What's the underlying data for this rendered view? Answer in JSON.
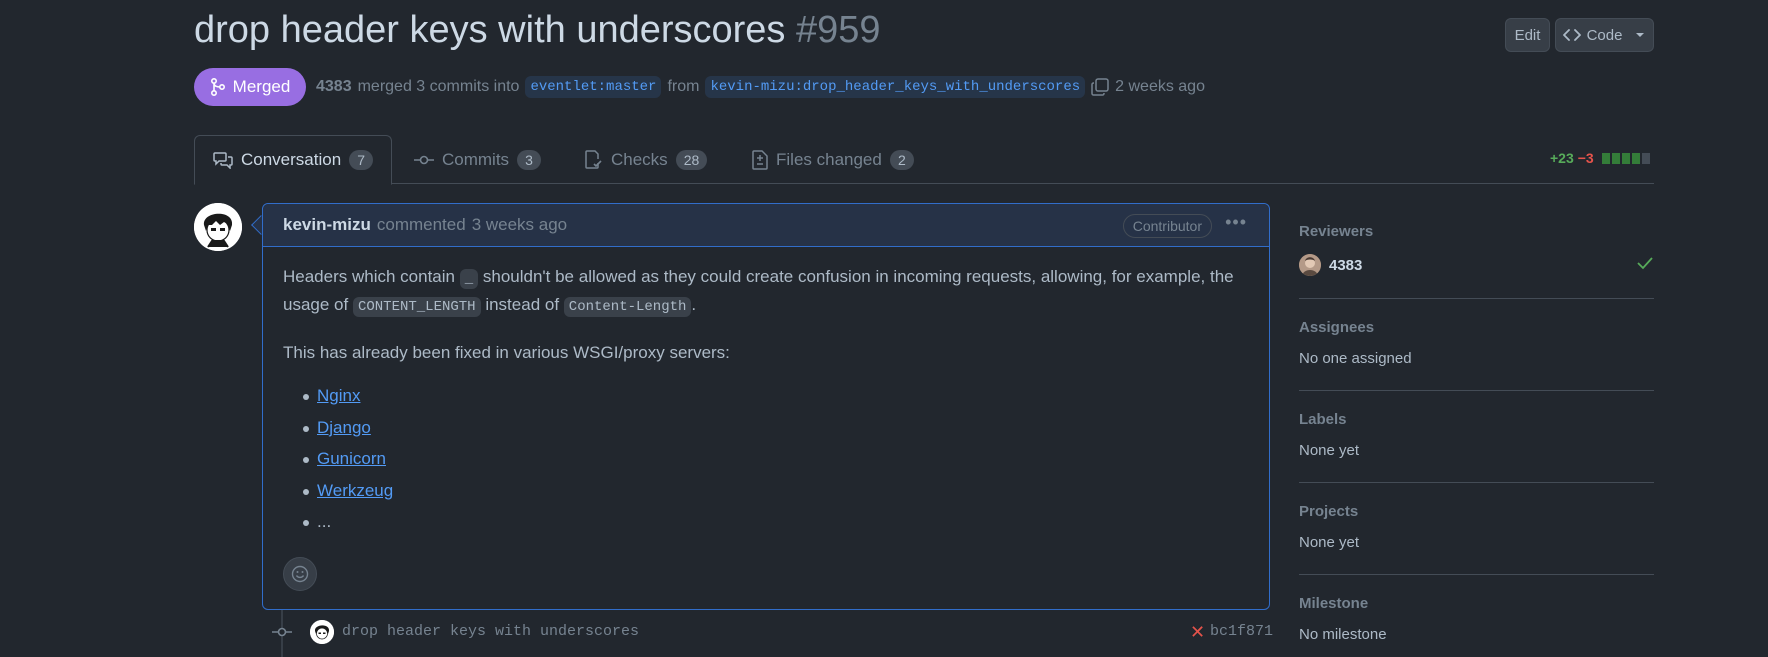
{
  "pr": {
    "title": "drop header keys with underscores",
    "number": "#959",
    "state": "Merged",
    "merger": "4383",
    "summary": "merged 3 commits into",
    "base_branch": "eventlet:master",
    "from_word": "from",
    "head_branch": "kevin-mizu:drop_header_keys_with_underscores",
    "time_ago": "2 weeks ago"
  },
  "header_actions": {
    "edit_label": "Edit",
    "code_label": "Code"
  },
  "tabs": [
    {
      "label": "Conversation",
      "count": "7",
      "icon": "comment-discussion-icon"
    },
    {
      "label": "Commits",
      "count": "3",
      "icon": "git-commit-icon"
    },
    {
      "label": "Checks",
      "count": "28",
      "icon": "checklist-icon"
    },
    {
      "label": "Files changed",
      "count": "2",
      "icon": "file-diff-icon"
    }
  ],
  "diffstat": {
    "additions": "+23",
    "deletions": "−3"
  },
  "comment": {
    "author": "kevin-mizu",
    "action": "commented",
    "time": "3 weeks ago",
    "role": "Contributor",
    "p1_a": "Headers which contain",
    "p1_code1": "_",
    "p1_b": "shouldn't be allowed as they could create confusion in incoming requests, allowing, for example, the usage of",
    "p1_code2": "CONTENT_LENGTH",
    "p1_c": "instead of",
    "p1_code3": "Content-Length",
    "p1_d": ".",
    "p2": "This has already been fixed in various WSGI/proxy servers:",
    "links": [
      "Nginx",
      "Django",
      "Gunicorn",
      "Werkzeug"
    ],
    "ellipsis": "..."
  },
  "commit": {
    "message": "drop header keys with underscores",
    "sha": "bc1f871",
    "status_icon": "x-icon",
    "status_color": "#e5534b"
  },
  "sidebar": {
    "reviewers_title": "Reviewers",
    "reviewer_name": "4383",
    "assignees_title": "Assignees",
    "assignees_value": "No one assigned",
    "labels_title": "Labels",
    "labels_value": "None yet",
    "projects_title": "Projects",
    "projects_value": "None yet",
    "milestone_title": "Milestone",
    "milestone_value": "No milestone"
  },
  "colors": {
    "background": "#22272e",
    "merged": "#986ee2",
    "link": "#539bf5",
    "add": "#57ab5a",
    "delete": "#e5534b"
  }
}
